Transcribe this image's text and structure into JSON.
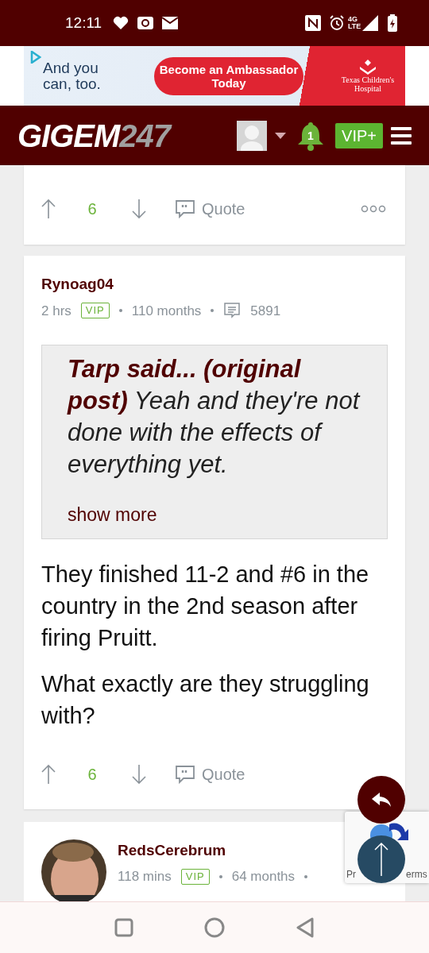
{
  "status_bar": {
    "time": "12:11",
    "network": "4G LTE"
  },
  "ad": {
    "headline": "And you can, too.",
    "button": "Become an Ambassador Today",
    "sponsor": "Texas Children's Hospital"
  },
  "header": {
    "logo_main": "GIGEM",
    "logo_num": "247",
    "notifications": "1",
    "vip": "VIP+"
  },
  "posts": [
    {
      "kind": "partial",
      "votes": "6",
      "quote_label": "Quote"
    },
    {
      "kind": "full",
      "author": "Rynoag04",
      "time": "2 hrs",
      "badge": "VIP",
      "tenure": "110 months",
      "post_count": "5891",
      "quote": "**Tarp said... (original post)** Yeah and they're not done with the effects of everything yet.",
      "show_more": "show more",
      "paragraphs": [
        "They finished 11-2 and #6 in the country in the 2nd season after firing Pruitt.",
        "What exactly are they struggling with?"
      ],
      "votes": "6",
      "quote_label": "Quote"
    },
    {
      "kind": "header_only",
      "author": "RedsCerebrum",
      "time": "118 mins",
      "badge": "VIP",
      "tenure": "64 months"
    }
  ],
  "recaptcha": {
    "text_left": "Pr",
    "text_right": "erms"
  }
}
